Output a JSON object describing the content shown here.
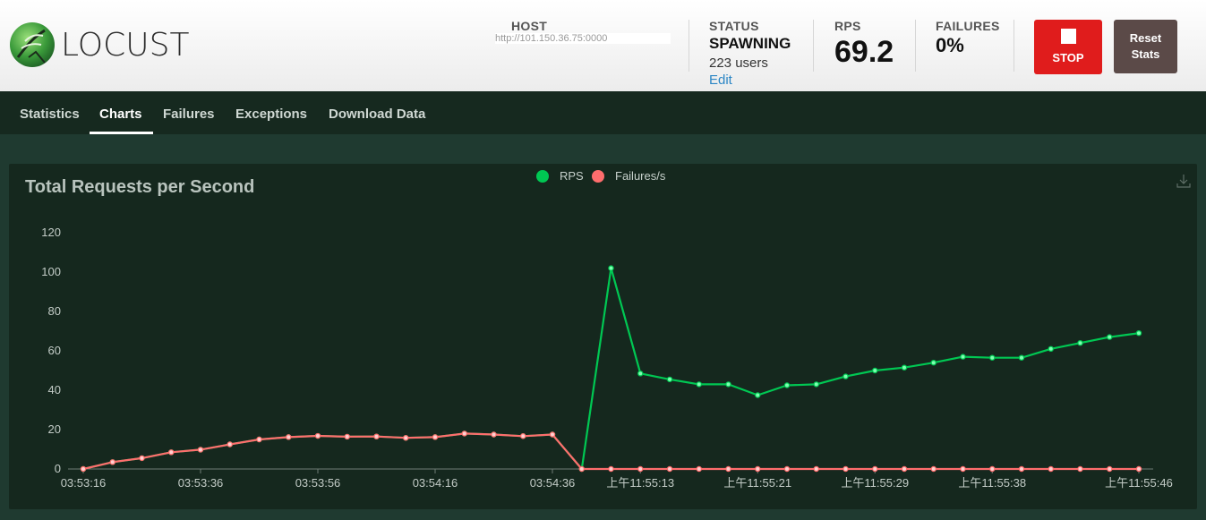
{
  "header": {
    "logo_text": "LOCUST",
    "host": {
      "label": "HOST",
      "value": "http://101.150.36.75:0000"
    },
    "status": {
      "label": "STATUS",
      "value": "SPAWNING",
      "users": "223 users",
      "edit": "Edit"
    },
    "rps": {
      "label": "RPS",
      "value": "69.2"
    },
    "failures": {
      "label": "FAILURES",
      "value": "0%"
    },
    "stop_label": "STOP",
    "reset_label": "Reset\nStats"
  },
  "nav": {
    "tabs": [
      "Statistics",
      "Charts",
      "Failures",
      "Exceptions",
      "Download Data"
    ],
    "active": "Charts"
  },
  "colors": {
    "rps": "#00c853",
    "failures": "#ff6d6d"
  },
  "chart_data": {
    "type": "line",
    "title": "Total Requests per Second",
    "ylim": [
      0,
      120
    ],
    "yticks": [
      0,
      20,
      40,
      60,
      80,
      100,
      120
    ],
    "tick_labels": [
      "03:53:16",
      "03:53:36",
      "03:53:56",
      "03:54:16",
      "03:54:36",
      "上午11:55:13",
      "上午11:55:21",
      "上午11:55:29",
      "上午11:55:38",
      "上午11:55:46"
    ],
    "tick_index": [
      0,
      4,
      8,
      12,
      16,
      19,
      23,
      27,
      31,
      36
    ],
    "series": [
      {
        "name": "RPS",
        "values": [
          0,
          3.5,
          5.5,
          8.5,
          9.8,
          12.5,
          15,
          16.2,
          16.8,
          16.4,
          16.5,
          15.8,
          16.2,
          18,
          17.5,
          16.7,
          17.5,
          0,
          102,
          48.5,
          45.5,
          43,
          43,
          37.5,
          42.5,
          43,
          47,
          50,
          51.5,
          54,
          57,
          56.5,
          56.5,
          61,
          64,
          67,
          69
        ]
      },
      {
        "name": "Failures/s",
        "values": [
          0,
          3.5,
          5.5,
          8.5,
          9.8,
          12.5,
          15,
          16.2,
          16.8,
          16.4,
          16.5,
          15.8,
          16.2,
          18,
          17.5,
          16.7,
          17.5,
          0,
          0,
          0,
          0,
          0,
          0,
          0,
          0,
          0,
          0,
          0,
          0,
          0,
          0,
          0,
          0,
          0,
          0,
          0,
          0
        ]
      }
    ],
    "legend": "top-center",
    "grid": false
  }
}
